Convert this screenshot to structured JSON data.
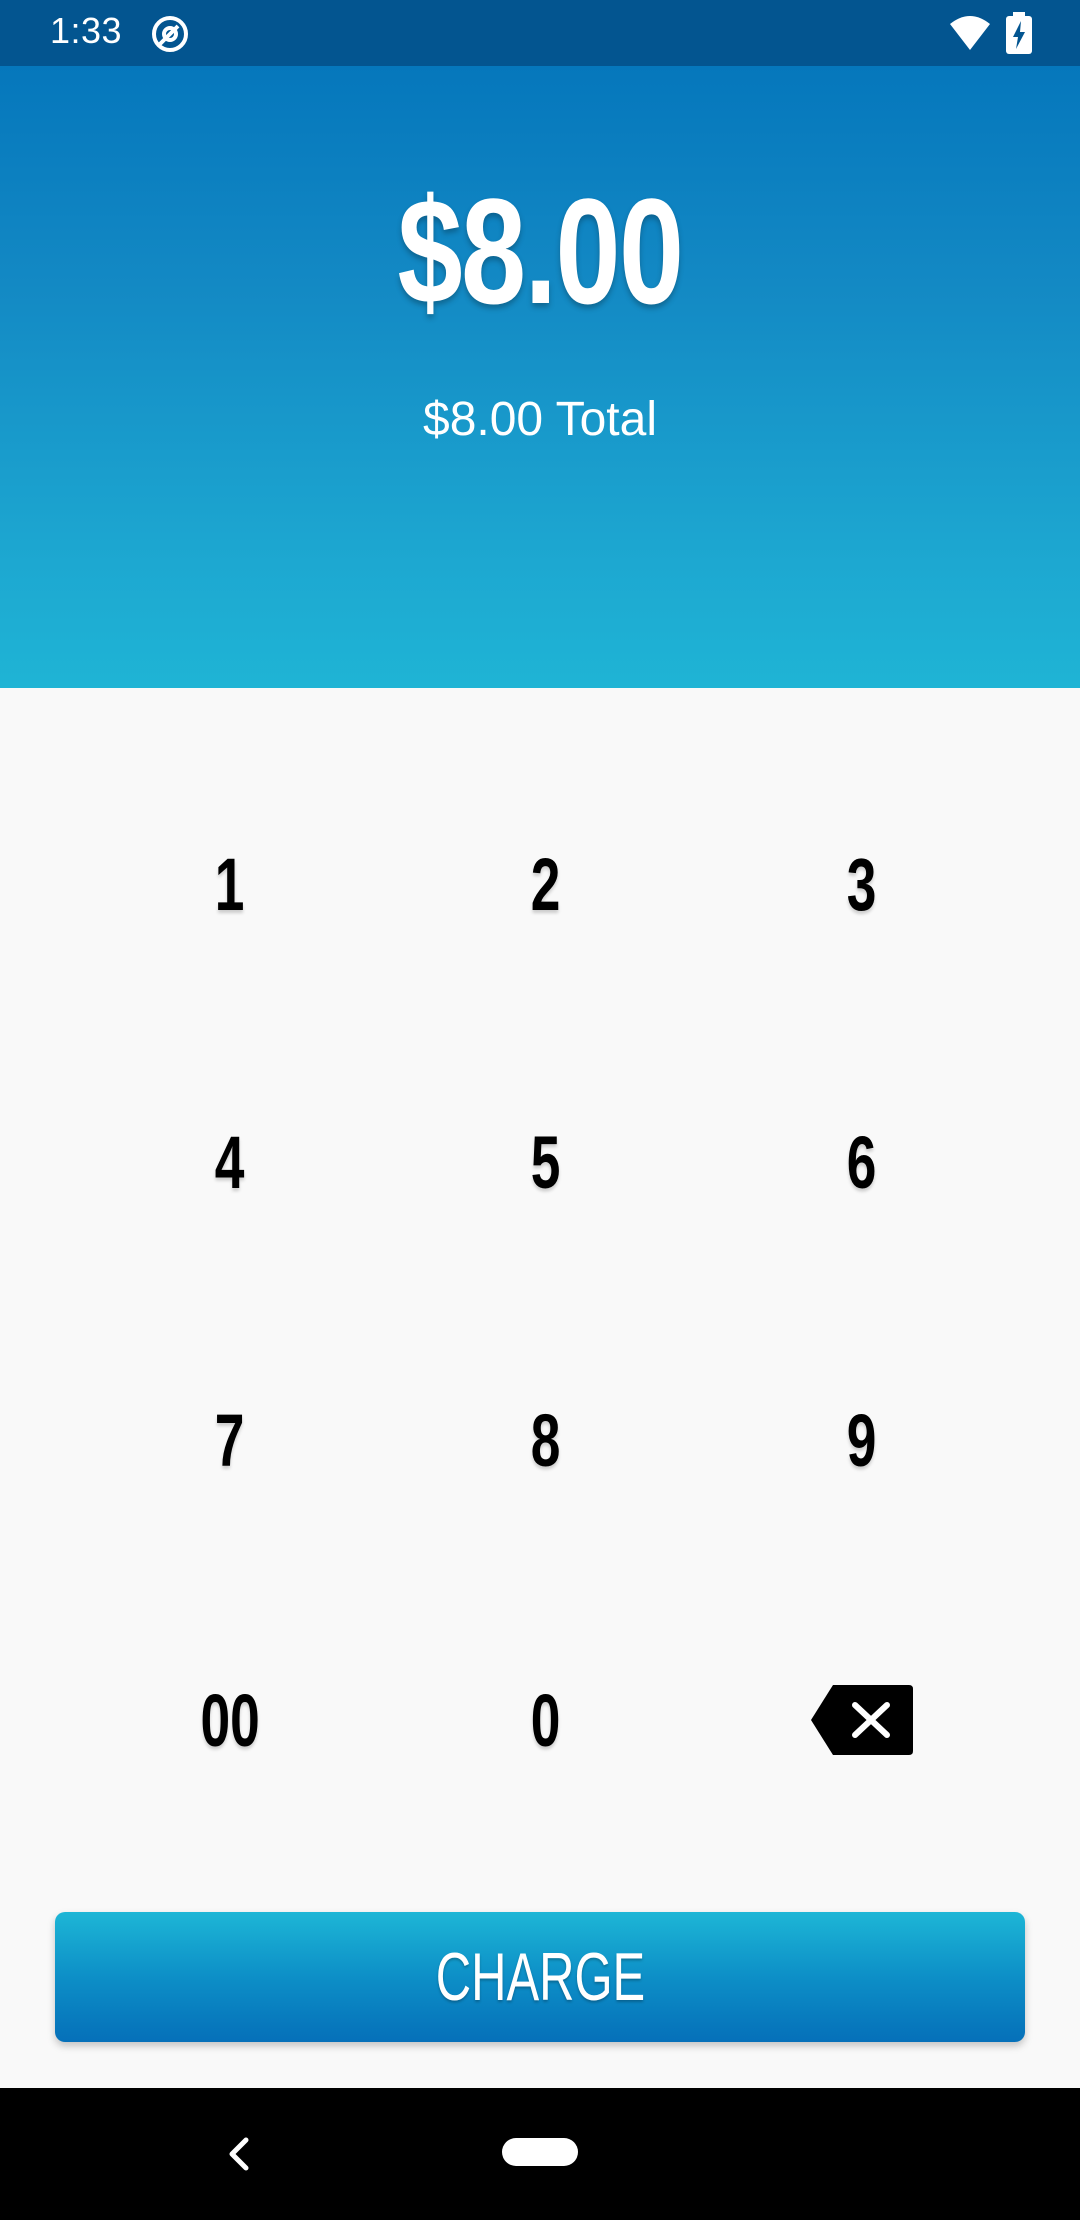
{
  "status_bar": {
    "time": "1:33",
    "app_icon": "at-sign-icon",
    "wifi_icon": "wifi-icon",
    "battery_icon": "battery-charging-icon"
  },
  "header": {
    "amount": "$8.00",
    "total_label": "$8.00 Total"
  },
  "keypad": {
    "keys": [
      "1",
      "2",
      "3",
      "4",
      "5",
      "6",
      "7",
      "8",
      "9",
      "00",
      "0"
    ],
    "backspace_icon": "backspace-icon"
  },
  "charge_button": {
    "label": "CHARGE"
  },
  "nav_bar": {
    "back_icon": "back-chevron-icon",
    "home_icon": "home-pill-icon"
  },
  "colors": {
    "status_bar": "#035590",
    "header_top": "#0577bc",
    "header_bottom": "#1fb4d5",
    "background": "#f9f9f9",
    "charge_top": "#1db6d6",
    "charge_bottom": "#0570b9"
  }
}
